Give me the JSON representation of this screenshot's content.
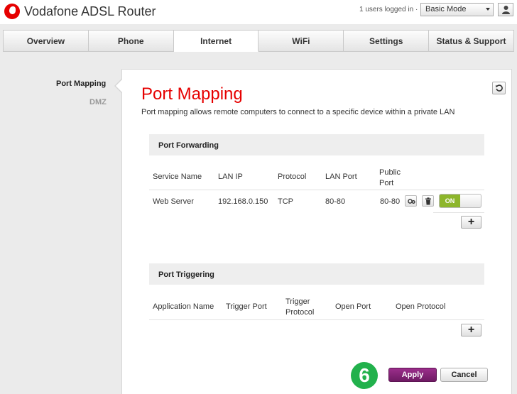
{
  "header": {
    "app_title": "Vodafone ADSL Router",
    "users_logged_in": "1 users logged in ·",
    "mode_selected": "Basic Mode"
  },
  "tabs": [
    "Overview",
    "Phone",
    "Internet",
    "WiFi",
    "Settings",
    "Status & Support"
  ],
  "active_tab": "Internet",
  "sidebar": {
    "items": [
      {
        "label": "Port Mapping",
        "active": true
      },
      {
        "label": "DMZ",
        "active": false
      }
    ]
  },
  "page": {
    "title": "Port Mapping",
    "description": "Port mapping allows remote computers to connect to a specific device within a private LAN"
  },
  "port_forwarding": {
    "section_title": "Port Forwarding",
    "columns": [
      "Service Name",
      "LAN IP",
      "Protocol",
      "LAN Port",
      "Public Port"
    ],
    "rows": [
      {
        "service_name": "Web Server",
        "lan_ip": "192.168.0.150",
        "protocol": "TCP",
        "lan_port": "80-80",
        "public_port": "80-80",
        "enabled_label": "ON"
      }
    ],
    "add_label": "+"
  },
  "port_triggering": {
    "section_title": "Port Triggering",
    "columns": [
      "Application Name",
      "Trigger Port",
      "Trigger Protocol",
      "Open Port",
      "Open Protocol"
    ],
    "rows": [],
    "add_label": "+"
  },
  "actions": {
    "step_number": "6",
    "apply_label": "Apply",
    "cancel_label": "Cancel"
  },
  "colors": {
    "brand": "#e60000",
    "apply": "#7d2270",
    "toggle_on": "#8db62b",
    "step_badge": "#22b14c"
  }
}
